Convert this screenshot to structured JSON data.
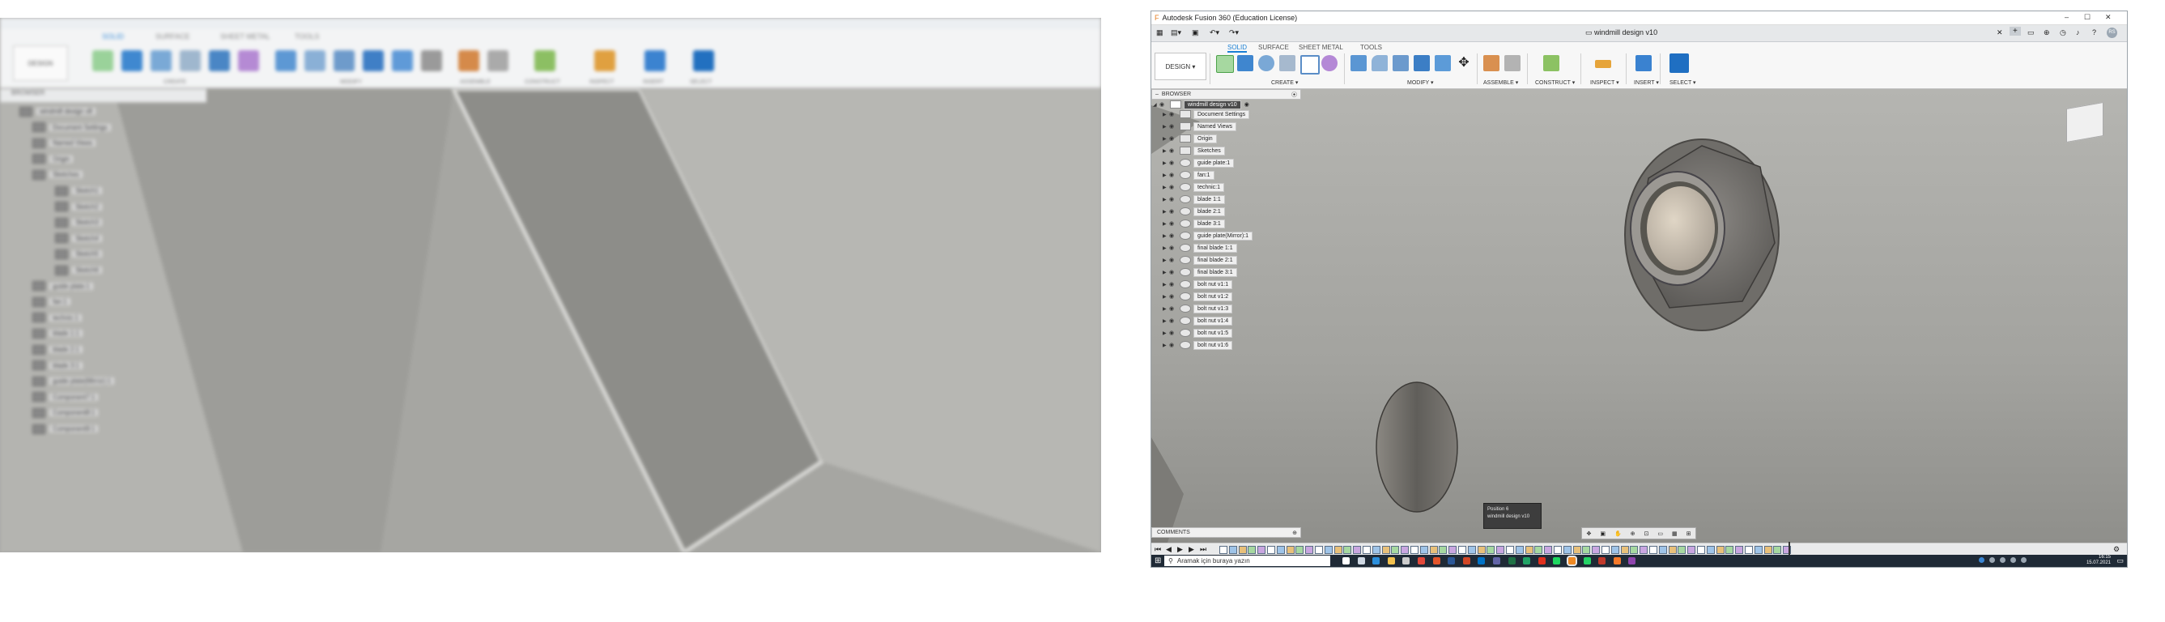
{
  "left_screenshot": {
    "tabs": [
      "SOLID",
      "SURFACE",
      "SHEET METAL",
      "TOOLS"
    ],
    "design_label": "DESIGN",
    "groups": [
      "CREATE",
      "MODIFY",
      "ASSEMBLE",
      "CONSTRUCT",
      "INSPECT",
      "INSERT",
      "SELECT"
    ],
    "browser_label": "BROWSER",
    "tree": [
      "windmill design v8",
      "Document Settings",
      "Named Views",
      "Origin",
      "Sketches",
      "Sketch1",
      "Sketch2",
      "Sketch3",
      "Sketch4",
      "Sketch5",
      "Sketch6",
      "guide plate:1",
      "fan:1",
      "technic:1",
      "blade 1:1",
      "blade 2:1",
      "blade 3:1",
      "guide plate(Mirror):1",
      "Component7:1",
      "Component8:1",
      "Component9:1"
    ]
  },
  "window": {
    "app_title": "Autodesk Fusion 360 (Education License)",
    "doc_title": "windmill design v10",
    "controls": {
      "minimize": "–",
      "maximize": "☐",
      "close": "✕"
    }
  },
  "ribbon": {
    "tabs": [
      "SOLID",
      "SURFACE",
      "SHEET METAL",
      "TOOLS"
    ],
    "active_tab": "SOLID",
    "design_label": "DESIGN",
    "groups": [
      "CREATE",
      "MODIFY",
      "ASSEMBLE",
      "CONSTRUCT",
      "INSPECT",
      "INSERT",
      "SELECT"
    ]
  },
  "browser": {
    "header": "BROWSER",
    "root": "windmill design v10",
    "items": [
      "Document Settings",
      "Named Views",
      "Origin",
      "Sketches",
      "guide plate:1",
      "fan:1",
      "technic:1",
      "blade 1:1",
      "blade 2:1",
      "blade 3:1",
      "guide plate(Mirror):1",
      "final blade 1:1",
      "final blade 2:1",
      "final blade 3:1",
      "bolt nut v1:1",
      "bolt nut v1:2",
      "bolt nut v1:3",
      "bolt nut v1:4",
      "bolt nut v1:5",
      "bolt nut v1:6"
    ]
  },
  "comments_label": "COMMENTS",
  "tooltip": {
    "title": "Position 6",
    "subtitle": "windmill design v10"
  },
  "taskbar": {
    "search_placeholder": "Aramak için buraya yazın",
    "time": "16:15",
    "date": "15.07.2021"
  },
  "colors": {
    "accent": "#1a7fd4",
    "taskbar": "#1f2a36",
    "viewport": "#a8a8a5"
  }
}
